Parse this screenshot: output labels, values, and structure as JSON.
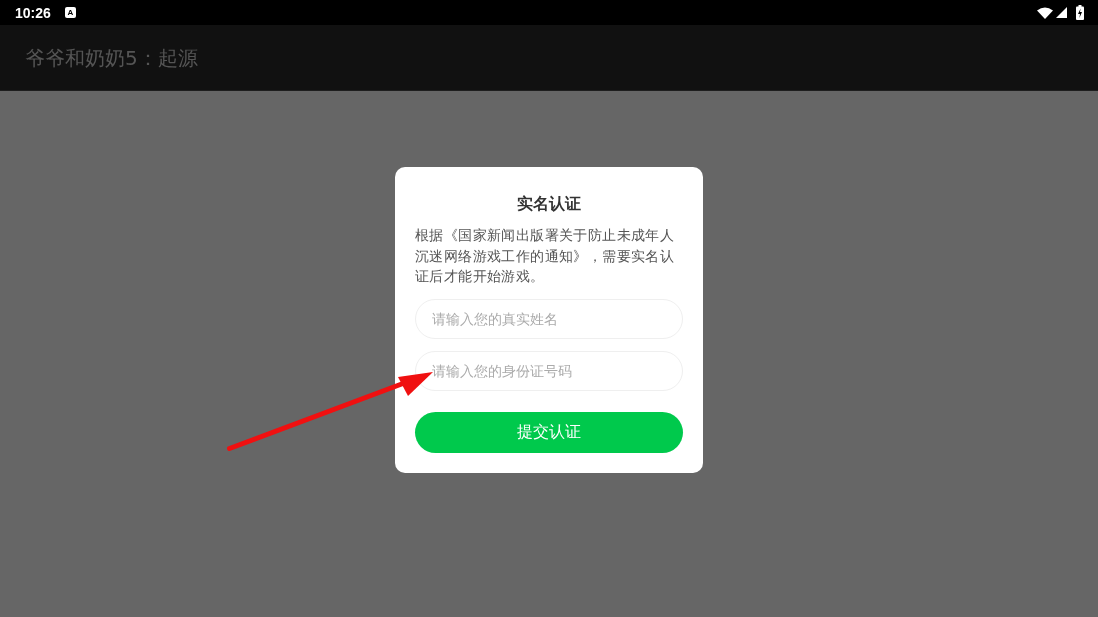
{
  "status_bar": {
    "time": "10:26",
    "notification_icon": "A"
  },
  "app_bar": {
    "title": "爷爷和奶奶5：起源"
  },
  "dialog": {
    "title": "实名认证",
    "message": "根据《国家新闻出版署关于防止未成年人沉迷网络游戏工作的通知》，需要实名认证后才能开始游戏。",
    "fields": [
      {
        "placeholder": "请输入您的真实姓名"
      },
      {
        "placeholder": "请输入您的身份证号码"
      }
    ],
    "submit_button": "提交认证"
  }
}
